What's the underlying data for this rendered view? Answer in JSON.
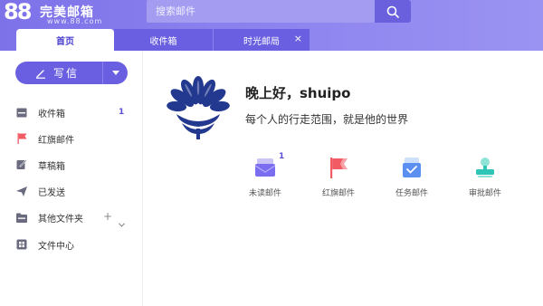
{
  "logo": {
    "number": "88",
    "name": "完美邮箱",
    "url": "www.88.com"
  },
  "search": {
    "placeholder": "搜索邮件"
  },
  "tabs": [
    {
      "label": "首页",
      "active": true
    },
    {
      "label": "收件箱",
      "active": false
    },
    {
      "label": "时光邮局",
      "active": false,
      "close": "×"
    }
  ],
  "compose": {
    "label": "写信"
  },
  "sidebar": {
    "items": [
      {
        "label": "收件箱",
        "icon": "inbox-icon",
        "count": "1"
      },
      {
        "label": "红旗邮件",
        "icon": "red-flag-icon"
      },
      {
        "label": "草稿箱",
        "icon": "draft-icon"
      },
      {
        "label": "已发送",
        "icon": "sent-icon"
      },
      {
        "label": "其他文件夹",
        "icon": "folder-icon",
        "add": "+"
      },
      {
        "label": "文件中心",
        "icon": "file-center-icon"
      }
    ]
  },
  "main": {
    "greeting": "晚上好，shuipo",
    "motto": "每个人的行走范围，就是他的世界",
    "quick": [
      {
        "label": "未读邮件",
        "icon": "unread-mail-icon",
        "badge": "1"
      },
      {
        "label": "红旗邮件",
        "icon": "red-flag-mail-icon"
      },
      {
        "label": "任务邮件",
        "icon": "task-mail-icon"
      },
      {
        "label": "审批邮件",
        "icon": "approval-mail-icon"
      }
    ]
  },
  "colors": {
    "accent": "#6a5fe0",
    "header": "#8a80ee",
    "flag": "#f25b64",
    "approval": "#2ec4b6"
  }
}
